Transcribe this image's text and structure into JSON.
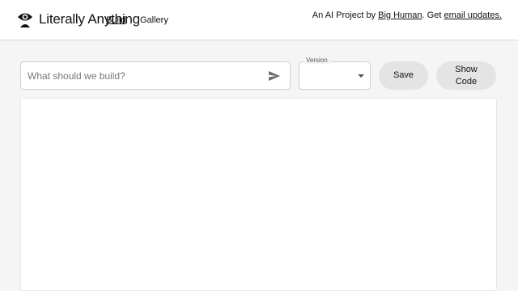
{
  "header": {
    "brand": "Literally Anything",
    "nav": {
      "build": "Build",
      "gallery": "Gallery"
    },
    "byline": {
      "prefix": "An AI Project by ",
      "org_link": "Big Human",
      "middle": ". Get ",
      "updates_link": "email updates."
    }
  },
  "toolbar": {
    "prompt_placeholder": "What should we build?",
    "prompt_value": "",
    "version_label": "Version",
    "version_value": "",
    "save_label": "Save",
    "show_code_line1": "Show",
    "show_code_line2": "Code"
  },
  "icons": {
    "logo": "eye-logo-icon",
    "send": "send-arrow-icon",
    "dropdown": "caret-down-icon"
  },
  "colors": {
    "background": "#f5f5f5",
    "header": "#ffffff",
    "button": "#e4e4e4"
  }
}
